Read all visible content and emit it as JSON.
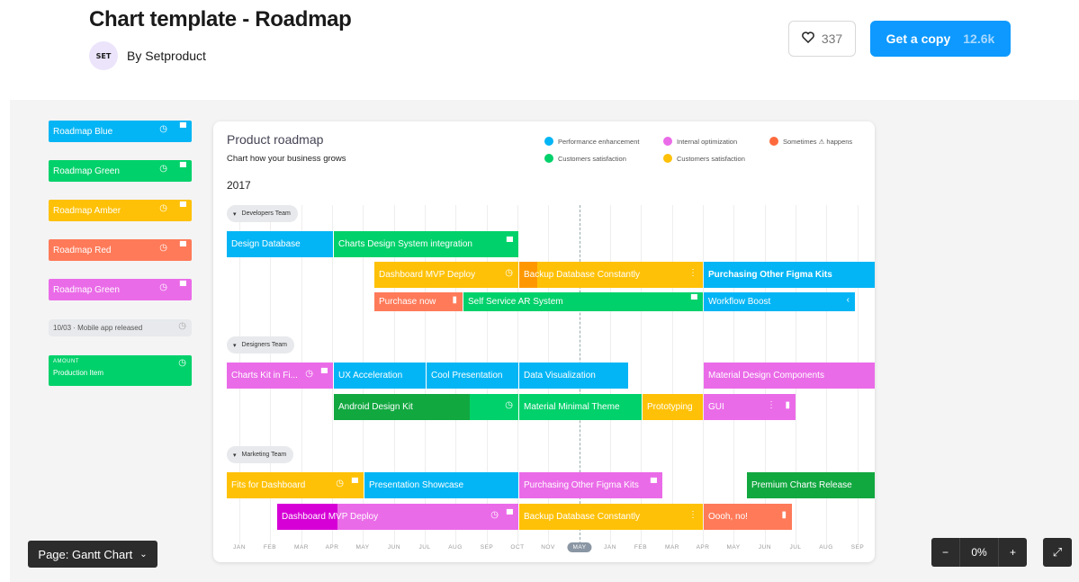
{
  "header": {
    "title": "Chart template - Roadmap",
    "author": "By Setproduct",
    "avatar_text": "SET",
    "like_count": "337",
    "copy_label": "Get a copy",
    "copy_count": "12.6k"
  },
  "colors": {
    "blue": "#04b5f5",
    "green": "#00d16a",
    "dark_green": "#12a840",
    "amber": "#ffc107",
    "orange": "#ff9800",
    "red": "#ff7a59",
    "pink": "#ea6be8",
    "magenta": "#d600d6",
    "accent": "#0d99ff"
  },
  "sidebar": [
    {
      "label": "Roadmap Blue",
      "color": "#04b5f5"
    },
    {
      "label": "Roadmap Green",
      "color": "#00d16a"
    },
    {
      "label": "Roadmap Amber",
      "color": "#ffc107"
    },
    {
      "label": "Roadmap Red",
      "color": "#ff7a59"
    },
    {
      "label": "Roadmap Green",
      "color": "#ea6be8"
    },
    {
      "label": "10/03 · Mobile app released",
      "color": "#e7e9ec"
    },
    {
      "small_label": "AMOUNT",
      "label": "Production Item",
      "color": "#00d16a"
    }
  ],
  "chart": {
    "title": "Product roadmap",
    "subtitle": "Chart how your business grows",
    "year": "2017",
    "legend": [
      {
        "label": "Performance enhancement",
        "color": "#04b5f5"
      },
      {
        "label": "Internal optimization",
        "color": "#ea6be8"
      },
      {
        "label": "Sometimes ⚠ happens",
        "color": "#ff6a3d"
      },
      {
        "label": "Customers satisfaction",
        "color": "#00d16a"
      },
      {
        "label": "Customers satisfaction",
        "color": "#ffc107"
      }
    ],
    "teams": [
      "Developers Team",
      "Designers Team",
      "Marketing Team"
    ],
    "months": [
      "JAN",
      "FEB",
      "MAR",
      "APR",
      "MAY",
      "JUN",
      "JUL",
      "AUG",
      "SEP",
      "OCT",
      "NOV",
      "MAY",
      "JAN",
      "FEB",
      "MAR",
      "APR",
      "MAY",
      "JUN",
      "JUL",
      "AUG",
      "SEP"
    ],
    "bars": [
      "Design Database",
      "Charts Design System integration",
      "Dashboard MVP Deploy",
      "Backup Database Constantly",
      "Purchasing Other Figma Kits",
      "Purchase now",
      "Self Service AR System",
      "Workflow Boost",
      "Charts Kit in Fi...",
      "UX Acceleration",
      "Cool Presentation",
      "Data Visualization",
      "Material Design Components",
      "Android Design Kit",
      "Material Minimal Theme",
      "Prototyping",
      "GUI",
      "Fits for Dashboard",
      "Presentation Showcase",
      "Purchasing Other Figma Kits",
      "Premium Charts Release",
      "Dashboard MVP Deploy",
      "Backup Database Constantly",
      "Oooh, no!"
    ]
  },
  "footer": {
    "page_label": "Page: Gantt Chart",
    "zoom_minus": "−",
    "zoom_value": "0%",
    "zoom_plus": "+"
  }
}
